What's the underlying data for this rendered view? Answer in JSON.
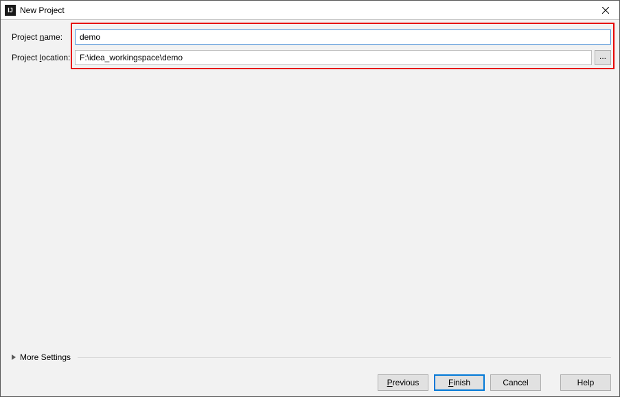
{
  "window": {
    "title": "New Project",
    "app_icon_text": "IJ"
  },
  "form": {
    "name_label_pre": "Project ",
    "name_label_mn": "n",
    "name_label_post": "ame:",
    "name_value": "demo",
    "location_label_pre": "Project ",
    "location_label_mn": "l",
    "location_label_post": "ocation:",
    "location_value": "F:\\idea_workingspace\\demo",
    "browse_label": "..."
  },
  "more_settings": {
    "label": "More Settings"
  },
  "buttons": {
    "previous_mn": "P",
    "previous_rest": "revious",
    "finish_mn": "F",
    "finish_rest": "inish",
    "cancel": "Cancel",
    "help": "Help"
  }
}
